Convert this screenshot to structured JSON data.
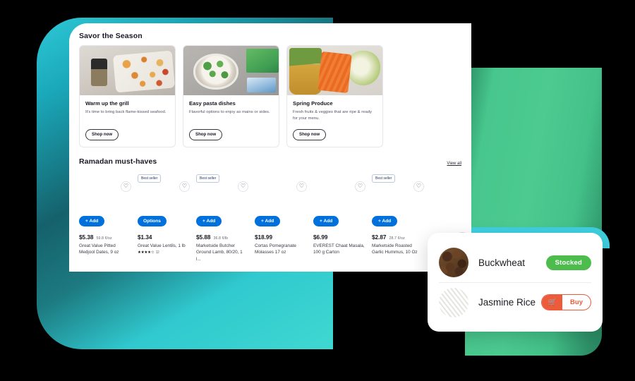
{
  "savor": {
    "title": "Savor the Season",
    "cards": [
      {
        "title": "Warm up the grill",
        "desc": "It's time to bring back flame-kissed seafood.",
        "cta": "Shop now"
      },
      {
        "title": "Easy pasta dishes",
        "desc": "Flavorful options to enjoy as mains or sides.",
        "cta": "Shop now"
      },
      {
        "title": "Spring Produce",
        "desc": "Fresh fruits & veggies that are ripe & ready for your menu.",
        "cta": "Shop now"
      }
    ]
  },
  "products": {
    "title": "Ramadan must-haves",
    "view_all": "View all",
    "next_icon": "›",
    "heart_icon": "♡",
    "items": [
      {
        "badge": "",
        "action": "+ Add",
        "price": "$5.38",
        "unit": "59.8 ¢/oz",
        "name": "Great Value Pitted Medjool Dates, 9 oz",
        "stars": "",
        "count": ""
      },
      {
        "badge": "Best seller",
        "action": "Options",
        "price": "$1.34",
        "unit": "",
        "name": "Great Value Lentils, 1 lb",
        "stars": "★★★★☆",
        "count": "12"
      },
      {
        "badge": "Best seller",
        "action": "+ Add",
        "price": "$5.88",
        "unit": "36.8 ¢/lb",
        "name": "Marketside Butcher Ground Lamb, 80/20, 1 l...",
        "stars": "",
        "count": ""
      },
      {
        "badge": "",
        "action": "+ Add",
        "price": "$18.99",
        "unit": "",
        "name": "Cortas Pomegranate Molasses 17 oz",
        "stars": "",
        "count": ""
      },
      {
        "badge": "",
        "action": "+ Add",
        "price": "$6.99",
        "unit": "",
        "name": "EVEREST Chaat Masala, 100 g Carton",
        "stars": "",
        "count": ""
      },
      {
        "badge": "Best seller",
        "action": "+ Add",
        "price": "$2.87",
        "unit": "28.7 ¢/oz",
        "name": "Marketside Roasted Garlic Hummus, 10 Oz",
        "stars": "",
        "count": ""
      }
    ]
  },
  "inventory": {
    "rows": [
      {
        "name": "Buckwheat",
        "status": "Stocked",
        "action": ""
      },
      {
        "name": "Jasmine Rice",
        "status": "",
        "action": "Buy",
        "cart_icon": "🛒"
      }
    ]
  },
  "colors": {
    "brand_blue": "#0071dc",
    "teal": "#2ec8d6",
    "green": "#4ccb90",
    "stocked_green": "#4cbd4c",
    "buy_orange": "#ee5b3a"
  }
}
